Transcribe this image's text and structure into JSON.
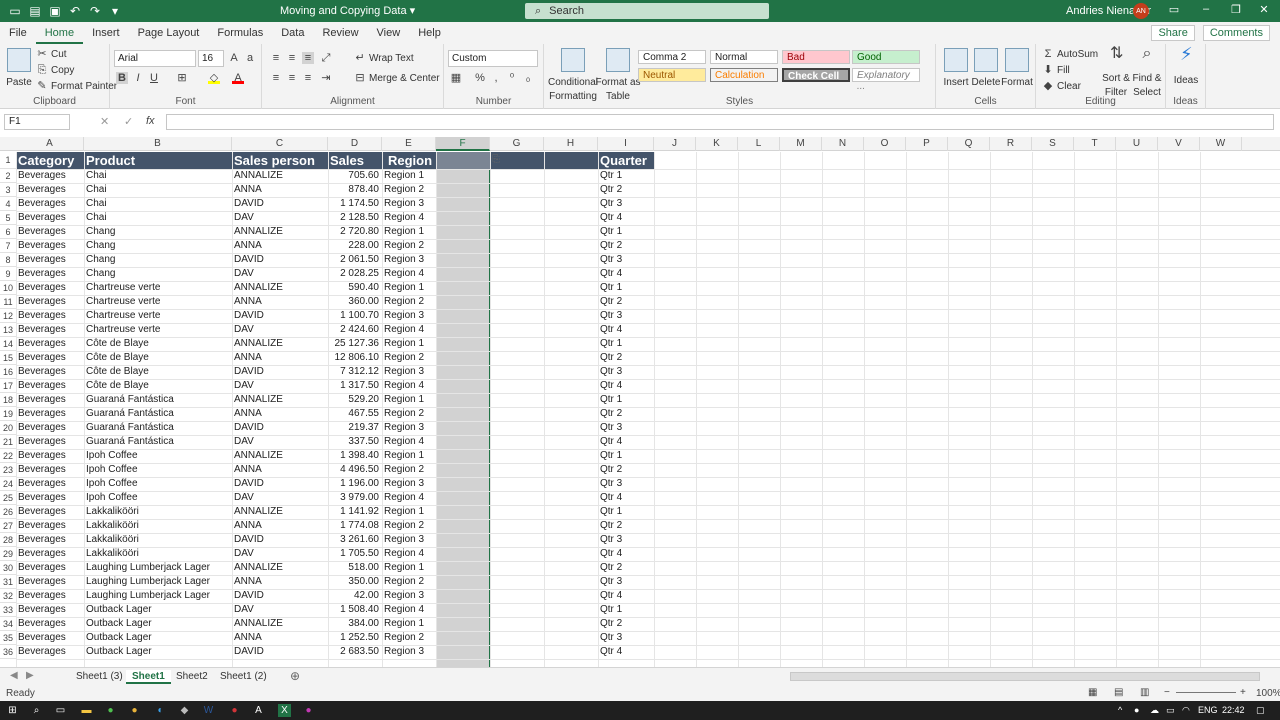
{
  "titlebar": {
    "doc_title": "Moving and Copying Data ▾",
    "search_placeholder": "Search",
    "user_name": "Andries Nienaber",
    "user_initials": "AN"
  },
  "menu": {
    "tabs": [
      "File",
      "Home",
      "Insert",
      "Page Layout",
      "Formulas",
      "Data",
      "Review",
      "View",
      "Help"
    ],
    "share": "Share",
    "comments": "Comments"
  },
  "ribbon": {
    "clipboard": {
      "paste": "Paste",
      "cut": "Cut",
      "copy": "Copy",
      "format_painter": "Format Painter",
      "label": "Clipboard"
    },
    "font": {
      "name": "Arial",
      "size": "16",
      "label": "Font"
    },
    "alignment": {
      "wrap": "Wrap Text",
      "merge": "Merge & Center",
      "label": "Alignment"
    },
    "number": {
      "format": "Custom",
      "label": "Number"
    },
    "styles": {
      "cond_fmt_1": "Conditional",
      "cond_fmt_2": "Formatting",
      "format_as_1": "Format as",
      "format_as_2": "Table",
      "comma2": "Comma 2",
      "normal": "Normal",
      "bad": "Bad",
      "good": "Good",
      "neutral": "Neutral",
      "calculation": "Calculation",
      "check_cell": "Check Cell",
      "explanatory": "Explanatory ...",
      "label": "Styles"
    },
    "cells": {
      "insert": "Insert",
      "delete": "Delete",
      "format": "Format",
      "label": "Cells"
    },
    "editing": {
      "autosum": "AutoSum",
      "fill": "Fill",
      "clear": "Clear",
      "sort_1": "Sort &",
      "sort_2": "Filter",
      "find_1": "Find &",
      "find_2": "Select",
      "label": "Editing"
    },
    "ideas": {
      "ideas": "Ideas",
      "label": "Ideas"
    }
  },
  "formula_bar": {
    "name_box": "F1",
    "fx": "fx",
    "value": ""
  },
  "columns": [
    "A",
    "B",
    "C",
    "D",
    "E",
    "F",
    "G",
    "H",
    "I",
    "J",
    "K",
    "L",
    "M",
    "N",
    "O",
    "P",
    "Q",
    "R",
    "S",
    "T",
    "U",
    "V",
    "W"
  ],
  "headers": {
    "category": "Category",
    "product": "Product",
    "salesperson": "Sales person",
    "sales": "Sales",
    "region": "Region",
    "quarter": "Quarter"
  },
  "rows": [
    [
      "Beverages",
      "Chai",
      "ANNALIZE",
      "705.60",
      "Region 1",
      "Qtr 1"
    ],
    [
      "Beverages",
      "Chai",
      "ANNA",
      "878.40",
      "Region 2",
      "Qtr 2"
    ],
    [
      "Beverages",
      "Chai",
      "DAVID",
      "1 174.50",
      "Region 3",
      "Qtr 3"
    ],
    [
      "Beverages",
      "Chai",
      "DAV",
      "2 128.50",
      "Region 4",
      "Qtr 4"
    ],
    [
      "Beverages",
      "Chang",
      "ANNALIZE",
      "2 720.80",
      "Region 1",
      "Qtr 1"
    ],
    [
      "Beverages",
      "Chang",
      "ANNA",
      "228.00",
      "Region 2",
      "Qtr 2"
    ],
    [
      "Beverages",
      "Chang",
      "DAVID",
      "2 061.50",
      "Region 3",
      "Qtr 3"
    ],
    [
      "Beverages",
      "Chang",
      "DAV",
      "2 028.25",
      "Region 4",
      "Qtr 4"
    ],
    [
      "Beverages",
      "Chartreuse    verte",
      "ANNALIZE",
      "590.40",
      "Region 1",
      "Qtr 1"
    ],
    [
      "Beverages",
      "Chartreuse verte",
      "ANNA",
      "360.00",
      "Region 2",
      "Qtr 2"
    ],
    [
      "Beverages",
      "Chartreuse verte",
      "DAVID",
      "1 100.70",
      "Region 3",
      "Qtr 3"
    ],
    [
      "Beverages",
      "Chartreuse verte",
      "DAV",
      "2 424.60",
      "Region 4",
      "Qtr 4"
    ],
    [
      "Beverages",
      "Côte de Blaye",
      "ANNALIZE",
      "25 127.36",
      "Region 1",
      "Qtr 1"
    ],
    [
      "Beverages",
      "Côte de Blaye",
      "ANNA",
      "12 806.10",
      "Region 2",
      "Qtr 2"
    ],
    [
      "Beverages",
      "Côte de Blaye",
      "DAVID",
      "7 312.12",
      "Region 3",
      "Qtr 3"
    ],
    [
      "Beverages",
      "Côte de Blaye",
      "DAV",
      "1 317.50",
      "Region 4",
      "Qtr 4"
    ],
    [
      "Beverages",
      "Guaraná Fantástica",
      "ANNALIZE",
      "529.20",
      "Region 1",
      "Qtr 1"
    ],
    [
      "Beverages",
      "Guaraná Fantástica",
      "ANNA",
      "467.55",
      "Region 2",
      "Qtr 2"
    ],
    [
      "Beverages",
      "Guaraná Fantástica",
      "DAVID",
      "219.37",
      "Region 3",
      "Qtr 3"
    ],
    [
      "Beverages",
      "Guaraná Fantástica",
      "DAV",
      "337.50",
      "Region 4",
      "Qtr 4"
    ],
    [
      "Beverages",
      "Ipoh Coffee",
      "ANNALIZE",
      "1 398.40",
      "Region 1",
      "Qtr 1"
    ],
    [
      "Beverages",
      "Ipoh Coffee",
      "ANNA",
      "4 496.50",
      "Region 2",
      "Qtr 2"
    ],
    [
      "Beverages",
      "Ipoh Coffee",
      "DAVID",
      "1 196.00",
      "Region 3",
      "Qtr 3"
    ],
    [
      "Beverages",
      "Ipoh Coffee",
      "DAV",
      "3 979.00",
      "Region 4",
      "Qtr 4"
    ],
    [
      "Beverages",
      "Lakkalikööri",
      "ANNALIZE",
      "1 141.92",
      "Region 1",
      "Qtr 1"
    ],
    [
      "Beverages",
      "Lakkalikööri",
      "ANNA",
      "1 774.08",
      "Region 2",
      "Qtr 2"
    ],
    [
      "Beverages",
      "Lakkalikööri",
      "DAVID",
      "3 261.60",
      "Region 3",
      "Qtr 3"
    ],
    [
      "Beverages",
      "Lakkalikööri",
      "DAV",
      "1 705.50",
      "Region 4",
      "Qtr 4"
    ],
    [
      "Beverages",
      "Laughing Lumberjack Lager",
      "ANNALIZE",
      "518.00",
      "Region 1",
      "Qtr 2"
    ],
    [
      "Beverages",
      "Laughing Lumberjack Lager",
      "ANNA",
      "350.00",
      "Region 2",
      "Qtr 3"
    ],
    [
      "Beverages",
      "Laughing Lumberjack Lager",
      "DAVID",
      "42.00",
      "Region 3",
      "Qtr 4"
    ],
    [
      "Beverages",
      "Outback Lager",
      "DAV",
      "1 508.40",
      "Region 4",
      "Qtr 1"
    ],
    [
      "Beverages",
      "Outback Lager",
      "ANNALIZE",
      "384.00",
      "Region 1",
      "Qtr 2"
    ],
    [
      "Beverages",
      "Outback Lager",
      "ANNA",
      "1 252.50",
      "Region 2",
      "Qtr 3"
    ],
    [
      "Beverages",
      "Outback Lager",
      "DAVID",
      "2 683.50",
      "Region 3",
      "Qtr 4"
    ]
  ],
  "sheets": [
    "Sheet1 (3)",
    "Sheet1",
    "Sheet2",
    "Sheet1 (2)"
  ],
  "status": {
    "ready": "Ready",
    "zoom": "100%"
  },
  "taskbar": {
    "lang": "ENG",
    "time": "22:42"
  }
}
